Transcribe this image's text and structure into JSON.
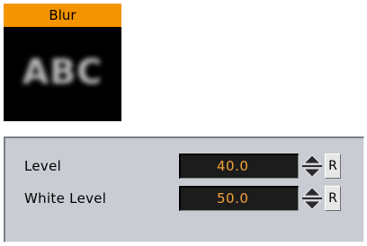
{
  "plugin": {
    "title": "Blur",
    "preview_text": "ABC",
    "header_color": "#f39400"
  },
  "properties": [
    {
      "label": "Level",
      "value": "40.0",
      "reset_label": "R"
    },
    {
      "label": "White Level",
      "value": "50.0",
      "reset_label": "R"
    }
  ],
  "colors": {
    "panel_background": "#c9ccd3",
    "field_background": "#1c1c1c",
    "value_text": "#f3a23a"
  },
  "icons": {
    "spinner_up": "arrow-up-icon",
    "spinner_down": "arrow-down-icon"
  }
}
